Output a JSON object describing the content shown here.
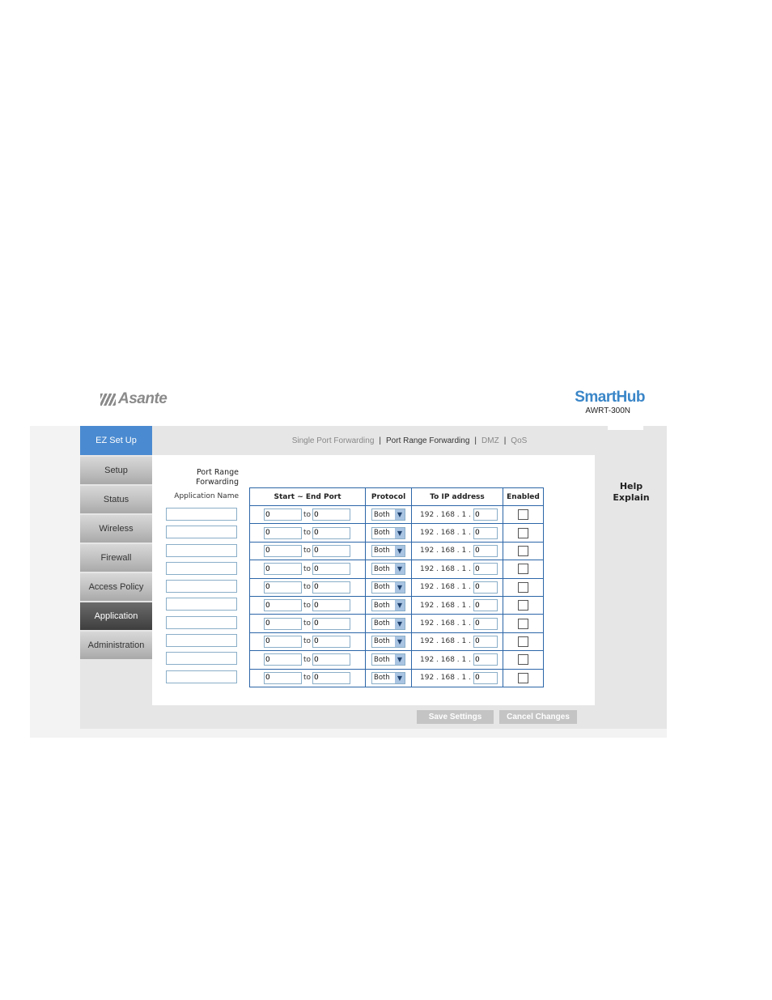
{
  "brand": {
    "vendor": "Asante",
    "product": "SmartHub",
    "model": "AWRT-300N"
  },
  "nav": {
    "items": [
      {
        "label": "EZ Set Up"
      },
      {
        "label": "Setup"
      },
      {
        "label": "Status"
      },
      {
        "label": "Wireless"
      },
      {
        "label": "Firewall"
      },
      {
        "label": "Access Policy"
      },
      {
        "label": "Application"
      },
      {
        "label": "Administration"
      }
    ]
  },
  "subnav": {
    "items": [
      {
        "label": "Single Port Forwarding"
      },
      {
        "label": "Port Range Forwarding"
      },
      {
        "label": "DMZ"
      },
      {
        "label": "QoS"
      }
    ],
    "separator": "|"
  },
  "section": {
    "title_line1": "Port Range",
    "title_line2": "Forwarding",
    "app_name_header": "Application Name"
  },
  "table": {
    "headers": {
      "port": "Start ~ End Port",
      "protocol": "Protocol",
      "ip": "To IP address",
      "enabled": "Enabled"
    },
    "to_label": "to",
    "ip_prefix": "192 . 168 . 1 .",
    "rows": [
      {
        "app": "",
        "start": "0",
        "end": "0",
        "protocol": "Both",
        "ip_last": "0",
        "enabled": false
      },
      {
        "app": "",
        "start": "0",
        "end": "0",
        "protocol": "Both",
        "ip_last": "0",
        "enabled": false
      },
      {
        "app": "",
        "start": "0",
        "end": "0",
        "protocol": "Both",
        "ip_last": "0",
        "enabled": false
      },
      {
        "app": "",
        "start": "0",
        "end": "0",
        "protocol": "Both",
        "ip_last": "0",
        "enabled": false
      },
      {
        "app": "",
        "start": "0",
        "end": "0",
        "protocol": "Both",
        "ip_last": "0",
        "enabled": false
      },
      {
        "app": "",
        "start": "0",
        "end": "0",
        "protocol": "Both",
        "ip_last": "0",
        "enabled": false
      },
      {
        "app": "",
        "start": "0",
        "end": "0",
        "protocol": "Both",
        "ip_last": "0",
        "enabled": false
      },
      {
        "app": "",
        "start": "0",
        "end": "0",
        "protocol": "Both",
        "ip_last": "0",
        "enabled": false
      },
      {
        "app": "",
        "start": "0",
        "end": "0",
        "protocol": "Both",
        "ip_last": "0",
        "enabled": false
      },
      {
        "app": "",
        "start": "0",
        "end": "0",
        "protocol": "Both",
        "ip_last": "0",
        "enabled": false
      }
    ]
  },
  "help": {
    "line1": "Help",
    "line2": "Explain"
  },
  "buttons": {
    "save": "Save Settings",
    "cancel": "Cancel Changes"
  },
  "colors": {
    "accent_blue": "#4a8ad0",
    "brand_blue": "#3a86c8",
    "table_border": "#2c66a8",
    "nav_active": "#3e3e3e"
  }
}
